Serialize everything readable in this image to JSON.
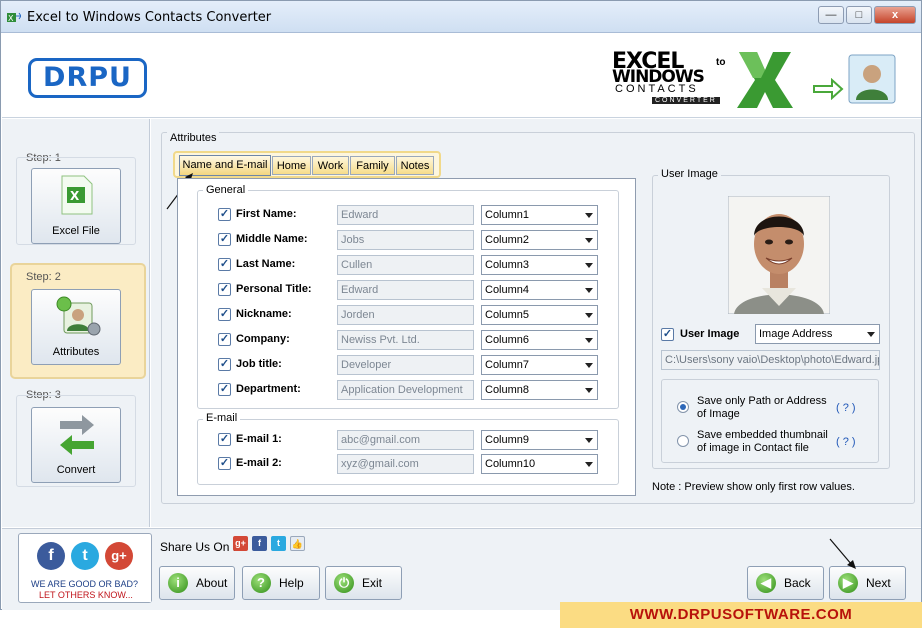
{
  "window": {
    "title": "Excel to Windows Contacts Converter",
    "min": "—",
    "max": "□",
    "close": "x"
  },
  "header": {
    "logo": "DRPU",
    "brand_line1": "EXCEL",
    "brand_to": "to",
    "brand_line2": "WINDOWS",
    "brand_line3": "CONTACTS",
    "brand_line4": "CONVERTER"
  },
  "steps": [
    {
      "step": "Step: 1",
      "label": "Excel File"
    },
    {
      "step": "Step: 2",
      "label": "Attributes"
    },
    {
      "step": "Step: 3",
      "label": "Convert"
    }
  ],
  "attributes_title": "Attributes",
  "tabs": [
    "Name and E-mail",
    "Home",
    "Work",
    "Family",
    "Notes"
  ],
  "general": {
    "title": "General",
    "fields": [
      {
        "label": "First Name:",
        "value": "Edward",
        "column": "Column1"
      },
      {
        "label": "Middle Name:",
        "value": "Jobs",
        "column": "Column2"
      },
      {
        "label": "Last Name:",
        "value": "Cullen",
        "column": "Column3"
      },
      {
        "label": "Personal Title:",
        "value": "Edward",
        "column": "Column4"
      },
      {
        "label": "Nickname:",
        "value": "Jorden",
        "column": "Column5"
      },
      {
        "label": "Company:",
        "value": "Newiss Pvt. Ltd.",
        "column": "Column6"
      },
      {
        "label": "Job title:",
        "value": "Developer",
        "column": "Column7"
      },
      {
        "label": "Department:",
        "value": "Application Development",
        "column": "Column8"
      }
    ]
  },
  "email": {
    "title": "E-mail",
    "fields": [
      {
        "label": "E-mail 1:",
        "value": "abc@gmail.com",
        "column": "Column9"
      },
      {
        "label": "E-mail 2:",
        "value": "xyz@gmail.com",
        "column": "Column10"
      }
    ]
  },
  "user_image": {
    "title": "User Image",
    "checkbox_label": "User Image",
    "type_select": "Image Address",
    "path": "C:\\Users\\sony vaio\\Desktop\\photo\\Edward.jpg",
    "option1_line1": "Save only Path or Address",
    "option1_line2": "of Image",
    "option2_line1": "Save embedded thumbnail",
    "option2_line2": "of image in Contact file",
    "help": "( ? )"
  },
  "note": "Note : Preview show only first row values.",
  "footer": {
    "share_label": "Share Us On :",
    "social_line1": "WE ARE GOOD OR BAD?",
    "social_line2": "LET OTHERS KNOW...",
    "about": "About",
    "help": "Help",
    "exit": "Exit",
    "back": "Back",
    "next": "Next"
  },
  "url": "WWW.DRPUSOFTWARE.COM",
  "colors": {
    "accent": "#1a66c4",
    "tab": "#f6dc8a",
    "step_active": "#fbecc4",
    "url_bg": "#fbdc83",
    "url_text": "#b8120b"
  }
}
